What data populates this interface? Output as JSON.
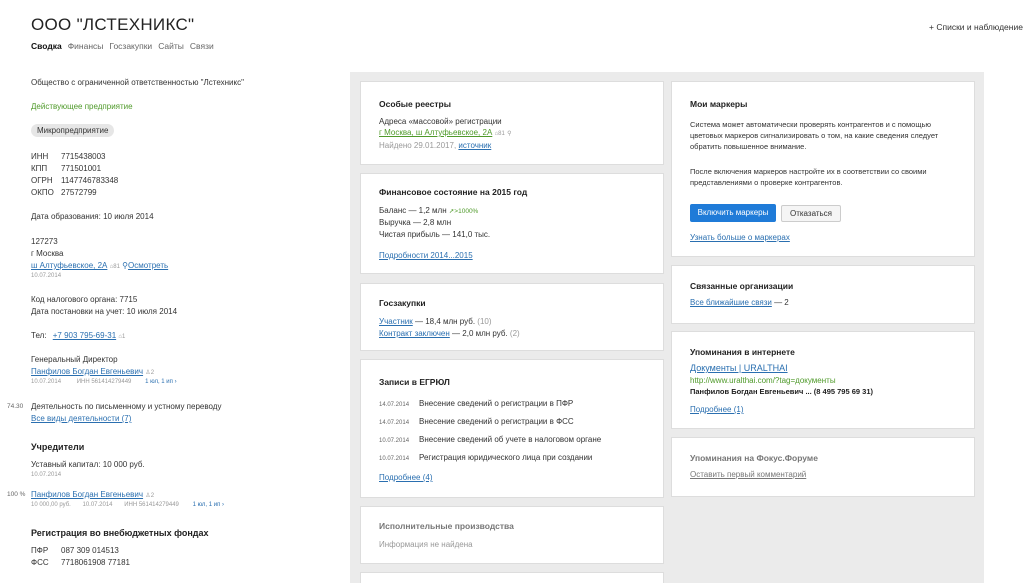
{
  "header": {
    "company_name": "ООО \"ЛСТЕХНИКС\"",
    "tabs": [
      "Сводка",
      "Финансы",
      "Госзакупки",
      "Сайты",
      "Связи"
    ],
    "lists_button": "Списки и наблюдение"
  },
  "left": {
    "full_name": "Общество с ограниченной ответственностью \"Лстехникс\"",
    "status": "Действующее предприятие",
    "size_badge": "Микропредприятие",
    "ids": [
      {
        "k": "ИНН",
        "v": "7715438003"
      },
      {
        "k": "КПП",
        "v": "771501001"
      },
      {
        "k": "ОГРН",
        "v": "1147746783348"
      },
      {
        "k": "ОКПО",
        "v": "27572799"
      }
    ],
    "founded": "Дата образования: 10 июля 2014",
    "postcode": "127273",
    "city": "г Москва",
    "address_link": "ш Алтуфьевское, 2А",
    "address_count": "81",
    "look_link": "Осмотреть",
    "address_date": "10.07.2014",
    "tax_code": "Код налогового органа: 7715",
    "tax_date": "Дата постановки на учет: 10 июля 2014",
    "tel_label": "Тел:",
    "tel": "+7 903 795-69-31",
    "tel_count": "1",
    "director_title": "Генеральный Директор",
    "director_name": "Панфилов Богдан Евгеньевич",
    "director_count": "2",
    "director_date": "10.07.2014",
    "director_inn": "ИНН 561414279449",
    "director_links": "1 юл, 1 ип",
    "activity_code": "74.30",
    "activity": "Деятельность по письменному и устному переводу",
    "activity_link": "Все виды деятельности (7)",
    "founders_title": "Учредители",
    "capital": "Уставный капитал: 10 000 руб.",
    "capital_date": "10.07.2014",
    "founder_share": "100 %",
    "founder_name": "Панфилов Богдан Евгеньевич",
    "founder_count": "2",
    "founder_amount": "10 000,00 руб.",
    "founder_date": "10.07.2014",
    "founder_inn": "ИНН 561414279449",
    "founder_links": "1 юл, 1 ип",
    "funds_title": "Регистрация во внебюджетных фондах",
    "funds": [
      {
        "k": "ПФР",
        "v": "087 309 014513"
      },
      {
        "k": "ФСС",
        "v": "7718061908 77181"
      }
    ]
  },
  "cards": {
    "registries": {
      "title": "Особые реестры",
      "label": "Адреса «массовой» регистрации",
      "address": "г Москва, ш Алтуфьевское, 2А",
      "count": "81",
      "found": "Найдено 29.01.2017,",
      "source": "источник"
    },
    "finance": {
      "title": "Финансовое состояние на 2015 год",
      "balance": "Баланс — 1,2 млн",
      "balance_growth": ">1000%",
      "revenue": "Выручка — 2,8 млн",
      "profit": "Чистая прибыль — 141,0 тыс.",
      "details": "Подробности 2014...2015"
    },
    "purchases": {
      "title": "Госзакупки",
      "participant": "Участник",
      "participant_val": "— 18,4 млн руб.",
      "participant_count": "(10)",
      "contract": "Контракт заключен",
      "contract_val": "— 2,0 млн руб.",
      "contract_count": "(2)"
    },
    "egrul": {
      "title": "Записи в ЕГРЮЛ",
      "entries": [
        {
          "date": "14.07.2014",
          "text": "Внесение сведений о регистрации в ПФР"
        },
        {
          "date": "14.07.2014",
          "text": "Внесение сведений о регистрации в ФСС"
        },
        {
          "date": "10.07.2014",
          "text": "Внесение сведений об учете в налоговом органе"
        },
        {
          "date": "10.07.2014",
          "text": "Регистрация юридического лица при создании"
        }
      ],
      "more": "Подробнее (4)"
    },
    "enforcement": {
      "title": "Исполнительные производства",
      "text": "Информация не найдена"
    },
    "markers": {
      "title": "Мои маркеры",
      "p1": "Система может автоматически проверять контрагентов и с помощью цветовых маркеров сигнализировать о том, на какие сведения следует обратить повышенное внимание.",
      "p2": "После включения маркеров настройте их в соответствии со своими представлениями о проверке контрагентов.",
      "enable": "Включить маркеры",
      "decline": "Отказаться",
      "learn": "Узнать больше о маркерах"
    },
    "related": {
      "title": "Связанные организации",
      "link": "Все ближайшие связи",
      "count": "— 2"
    },
    "mentions": {
      "title": "Упоминания в интернете",
      "link": "Документы | URALTHAI",
      "url": "http://www.uralthai.com/?tag=документы",
      "snippet": "Панфилов Богдан Евгеньевич ... (8 495 795 69 31)",
      "more": "Подробнее (1)"
    },
    "forum": {
      "title": "Упоминания на Фокус.Форуме",
      "link": "Оставить первый комментарий"
    }
  }
}
